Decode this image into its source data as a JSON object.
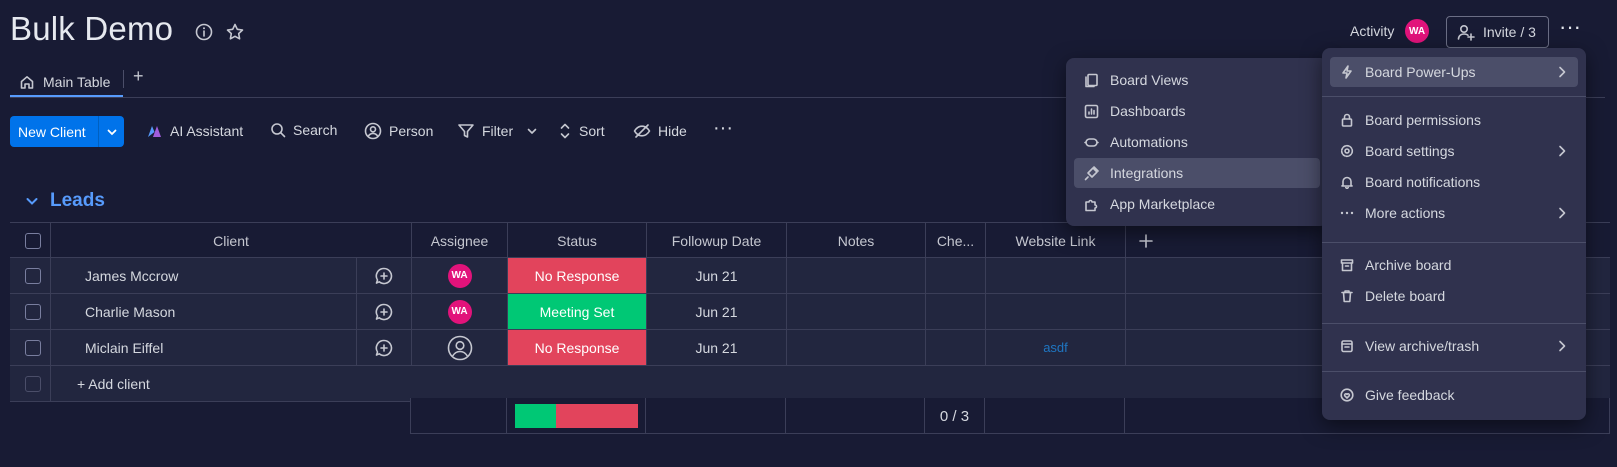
{
  "header": {
    "board_title": "Bulk Demo",
    "activity_label": "Activity",
    "activity_avatar": "WA",
    "invite_label": "Invite / 3",
    "more_label": "···"
  },
  "tabs": {
    "main_table": "Main Table",
    "add": "+"
  },
  "toolbar": {
    "new_client": "New Client",
    "ai_assistant": "AI Assistant",
    "search": "Search",
    "person": "Person",
    "filter": "Filter",
    "sort": "Sort",
    "hide": "Hide",
    "more": "···"
  },
  "group": {
    "title": "Leads",
    "color": "#579bfc"
  },
  "table": {
    "columns": [
      "Client",
      "Assignee",
      "Status",
      "Followup Date",
      "Notes",
      "Che...",
      "Website Link"
    ],
    "rows": [
      {
        "client": "James Mccrow",
        "assignee": "WA",
        "status": "No Response",
        "status_color": "#e2445c",
        "date": "Jun 21",
        "website": ""
      },
      {
        "client": "Charlie Mason",
        "assignee": "WA",
        "status": "Meeting Set",
        "status_color": "#00c875",
        "date": "Jun 21",
        "website": ""
      },
      {
        "client": "Miclain Eiffel",
        "assignee": "",
        "status": "No Response",
        "status_color": "#e2445c",
        "date": "Jun 21",
        "website": "asdf"
      }
    ],
    "add_item": "+ Add client",
    "summary_check": "0 / 3"
  },
  "menu_views": {
    "items": [
      "Board Views",
      "Dashboards",
      "Automations",
      "Integrations",
      "App Marketplace"
    ]
  },
  "menu_board": {
    "items": [
      "Board Power-Ups",
      "Board permissions",
      "Board settings",
      "Board notifications",
      "More actions",
      "Archive board",
      "Delete board",
      "View archive/trash",
      "Give feedback"
    ]
  },
  "icons": [
    "info-icon",
    "star-icon",
    "home-icon",
    "person-add-icon",
    "sparkle-icon",
    "search-icon",
    "person-icon",
    "filter-icon",
    "sort-icon",
    "eye-hide-icon",
    "update-bubble-icon",
    "lightning-icon",
    "lock-icon",
    "gear-icon",
    "bell-icon",
    "archive-icon",
    "trash-icon",
    "feedback-icon"
  ]
}
